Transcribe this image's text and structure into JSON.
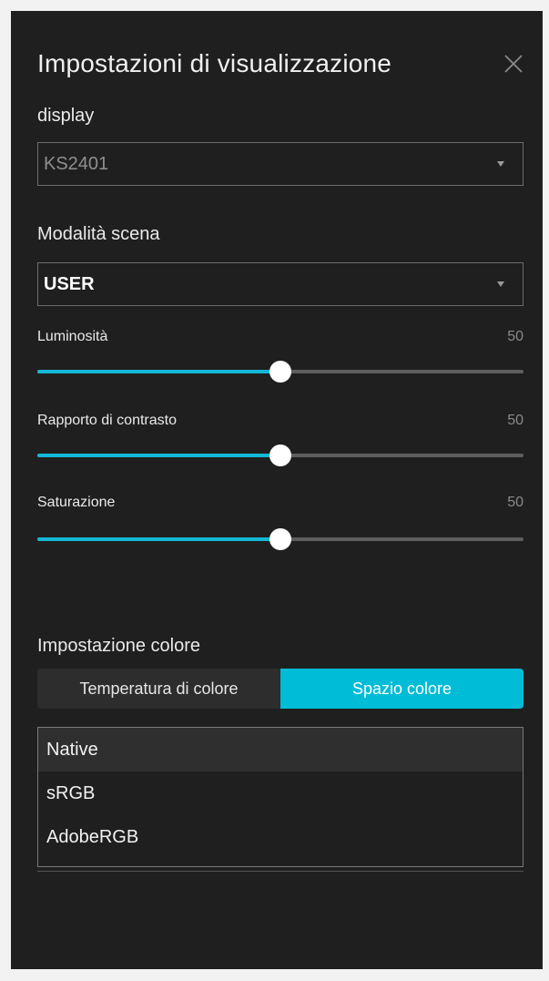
{
  "panel": {
    "title": "Impostazioni di visualizzazione",
    "close_icon": "close-icon"
  },
  "display": {
    "label": "display",
    "value": "KS2401",
    "enabled": false
  },
  "scene": {
    "label": "Modalità scena",
    "value": "USER"
  },
  "sliders": [
    {
      "label": "Luminosità",
      "value": "50",
      "level": 0.5
    },
    {
      "label": "Rapporto di contrasto",
      "value": "50",
      "level": 0.5
    },
    {
      "label": "Saturazione",
      "value": "50",
      "level": 0.5
    }
  ],
  "color": {
    "label": "Impostazione colore",
    "tabs": [
      "Temperatura di colore",
      "Spazio colore"
    ],
    "active_tab": "Spazio colore",
    "options": [
      "Native",
      "sRGB",
      "AdobeRGB"
    ],
    "selected_option": "Native"
  },
  "colors": {
    "panel_bg": "#1f1f1f",
    "accent": "#00bcd6",
    "slider_fill": "#12b8d6",
    "track": "#5e5e5e"
  }
}
